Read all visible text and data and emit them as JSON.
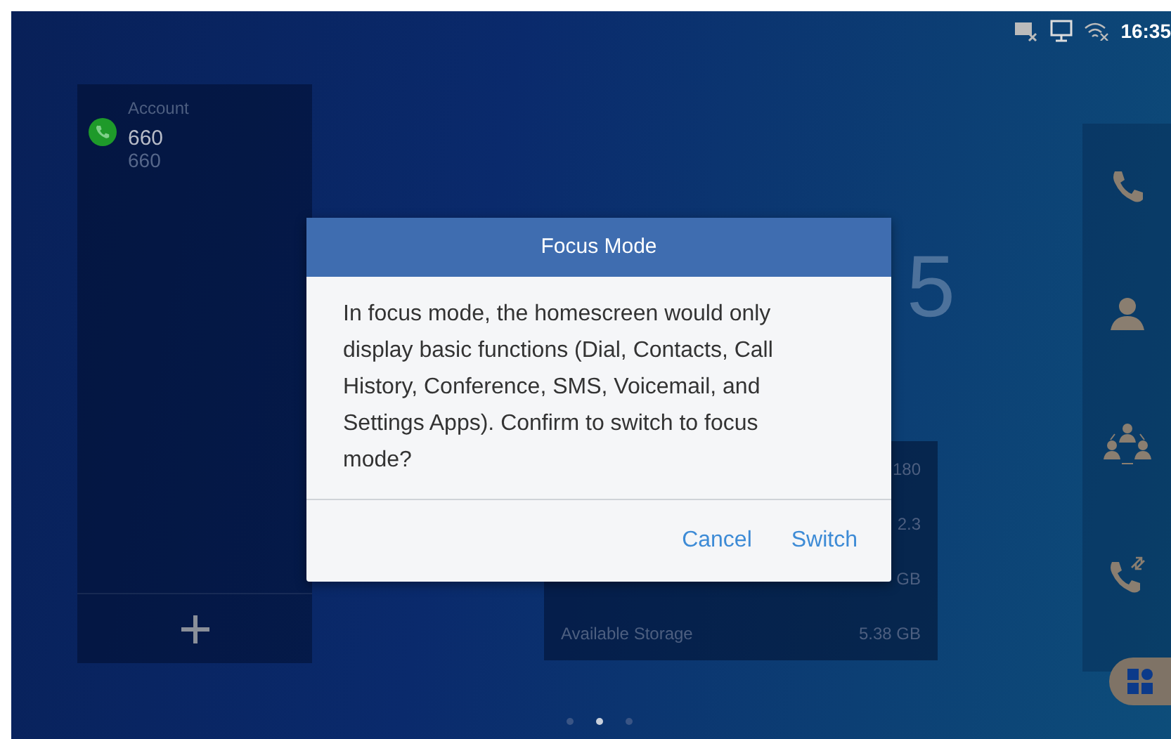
{
  "status_bar": {
    "time": "16:35"
  },
  "account_panel": {
    "label": "Account",
    "name": "660",
    "number": "660"
  },
  "clock": {
    "text": "5"
  },
  "storage_panel": {
    "rows": [
      {
        "label": "",
        "value": "180"
      },
      {
        "label": "",
        "value": "2.3"
      },
      {
        "label": "",
        "value": "GB"
      },
      {
        "label": "Available Storage",
        "value": "5.38 GB"
      }
    ]
  },
  "page_indicator": [
    {
      "selected": false
    },
    {
      "selected": true
    },
    {
      "selected": false
    }
  ],
  "dialog": {
    "title": "Focus Mode",
    "message": "In focus mode, the homescreen would only display basic functions (Dial, Contacts, Call History, Conference, SMS, Voicemail, and Settings Apps). Confirm to switch to focus mode?",
    "buttons": [
      "Cancel",
      "Switch"
    ]
  }
}
